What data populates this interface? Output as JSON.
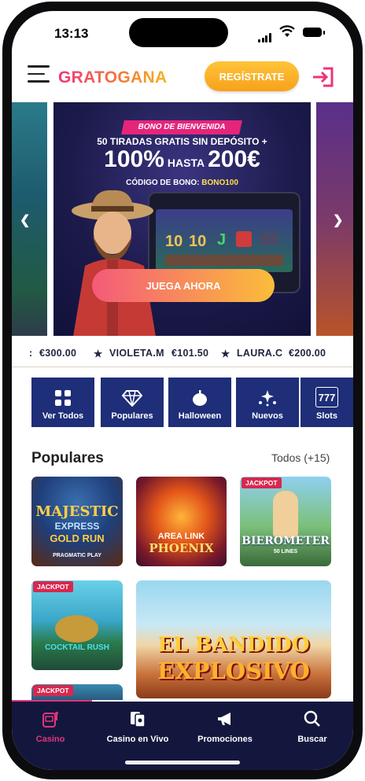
{
  "status_bar": {
    "time": "13:13"
  },
  "header": {
    "logo": "GRATOGANA",
    "register_label": "REGÍSTRATE"
  },
  "banner": {
    "pill": "BONO DE BIENVENIDA",
    "line1": "50 TIRADAS GRATIS SIN DEPÓSITO +",
    "percent": "100%",
    "hasta": "HASTA",
    "amount": "200€",
    "code_label": "CÓDIGO DE BONO:",
    "code_value": "BONO100",
    "cta": "JUEGA AHORA"
  },
  "ticker": {
    "items": [
      {
        "amount": "€300.00"
      },
      {
        "name": "VIOLETA.M",
        "amount": "€101.50"
      },
      {
        "name": "LAURA.C",
        "amount": "€200.00"
      }
    ]
  },
  "categories": [
    {
      "label": "Ver Todos",
      "icon": "grid-icon"
    },
    {
      "label": "Populares",
      "icon": "diamond-icon"
    },
    {
      "label": "Halloween",
      "icon": "pumpkin-icon"
    },
    {
      "label": "Nuevos",
      "icon": "sparkle-icon"
    },
    {
      "label": "Slots",
      "icon": "777-icon"
    }
  ],
  "populares": {
    "title": "Populares",
    "more": "Todos (+15)",
    "games": [
      {
        "title": "MAJESTIC",
        "sub": "EXPRESS",
        "sub2": "GOLD RUN",
        "provider": "PRAGMATIC PLAY"
      },
      {
        "title": "AREA LINK",
        "sub": "PHOENIX"
      },
      {
        "title": "BIEROMETER",
        "sub": "50 LINES",
        "badge": "JACKPOT"
      },
      {
        "title": "COCKTAIL RUSH",
        "badge": "JACKPOT"
      },
      {
        "title": "EL BANDIDO",
        "sub": "EXPLOSIVO"
      },
      {
        "badge": "JACKPOT"
      }
    ]
  },
  "nav": {
    "items": [
      {
        "label": "Casino",
        "icon": "slot-machine-icon",
        "active": true
      },
      {
        "label": "Casino en Vivo",
        "icon": "cards-icon"
      },
      {
        "label": "Promociones",
        "icon": "megaphone-icon"
      },
      {
        "label": "Buscar",
        "icon": "search-icon"
      }
    ]
  },
  "colors": {
    "brand_pink": "#f0337b",
    "brand_orange": "#f7a21a",
    "navy": "#1e2e78",
    "nav_bg": "#14173d"
  }
}
